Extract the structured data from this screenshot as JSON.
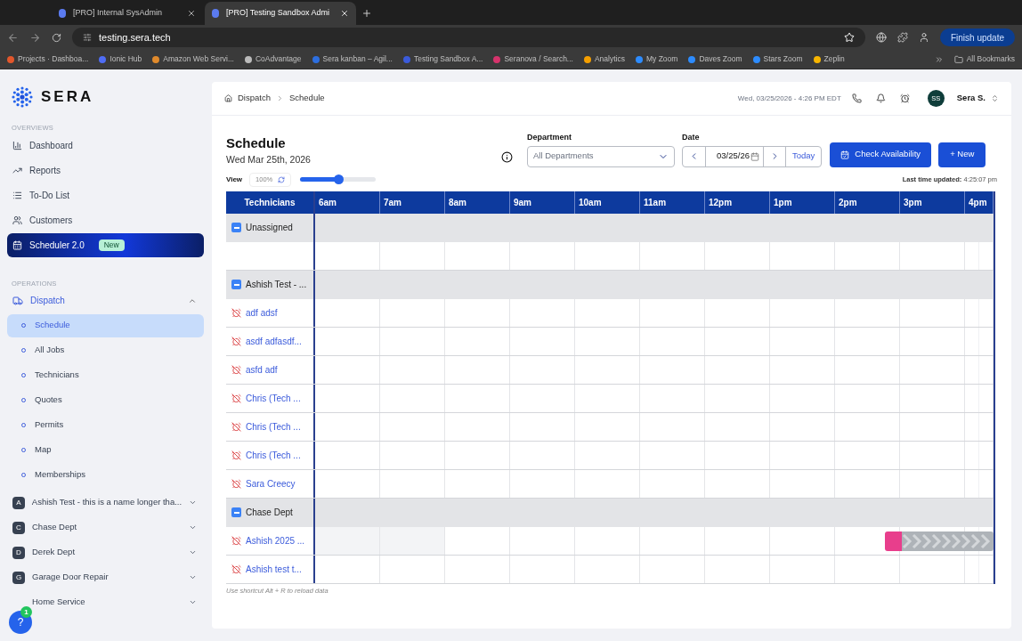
{
  "browser": {
    "tabs": [
      {
        "title": "[PRO] Internal SysAdmin",
        "selected": false
      },
      {
        "title": "[PRO] Testing Sandbox Admi",
        "selected": true
      }
    ],
    "address": "testing.sera.tech",
    "update_button": "Finish update",
    "bookmarks": [
      {
        "label": "Projects · Dashboa...",
        "color": "#e2572c"
      },
      {
        "label": "Ionic Hub",
        "color": "#4f6df5"
      },
      {
        "label": "Amazon Web Servi...",
        "color": "#e08a2c"
      },
      {
        "label": "CoAdvantage",
        "color": "#bbbbbb"
      },
      {
        "label": "Sera kanban – Agil...",
        "color": "#2d6fe0"
      },
      {
        "label": "Testing Sandbox A...",
        "color": "#3b5bdb"
      },
      {
        "label": "Seranova / Search...",
        "color": "#d6336c"
      },
      {
        "label": "Analytics",
        "color": "#f59f00"
      },
      {
        "label": "My Zoom",
        "color": "#2d8cff"
      },
      {
        "label": "Daves Zoom",
        "color": "#2d8cff"
      },
      {
        "label": "Stars Zoom",
        "color": "#2d8cff"
      },
      {
        "label": "Zeplin",
        "color": "#f7b500"
      }
    ],
    "all_bookmarks": "All Bookmarks"
  },
  "sidebar": {
    "logo": "SERA",
    "overviews_heading": "OVERVIEWS",
    "overviews": [
      {
        "label": "Dashboard"
      },
      {
        "label": "Reports"
      },
      {
        "label": "To-Do List"
      },
      {
        "label": "Customers"
      }
    ],
    "promo": {
      "label": "Scheduler 2.0",
      "badge": "New"
    },
    "operations_heading": "OPERATIONS",
    "dispatch": {
      "label": "Dispatch",
      "expanded": true,
      "children": [
        {
          "label": "Schedule",
          "selected": true
        },
        {
          "label": "All Jobs",
          "selected": false
        },
        {
          "label": "Technicians",
          "selected": false
        },
        {
          "label": "Quotes",
          "selected": false
        },
        {
          "label": "Permits",
          "selected": false
        },
        {
          "label": "Map",
          "selected": false
        },
        {
          "label": "Memberships",
          "selected": false
        }
      ]
    },
    "departments": [
      {
        "letter": "A",
        "label": "Ashish Test - this is a name longer tha..."
      },
      {
        "letter": "C",
        "label": "Chase Dept"
      },
      {
        "letter": "D",
        "label": "Derek Dept"
      },
      {
        "letter": "G",
        "label": "Garage Door Repair"
      },
      {
        "label": "Home Service"
      }
    ],
    "help": {
      "label": "?",
      "count": "1"
    }
  },
  "header": {
    "breadcrumbs": [
      "Dispatch",
      "Schedule"
    ],
    "datetime": "Wed, 03/25/2026 - 4:26 PM EDT",
    "initials": "SS",
    "user": "Sera S."
  },
  "schedule": {
    "title": "Schedule",
    "date": "Wed Mar 25th, 2026",
    "department_label": "Department",
    "department_placeholder": "All Departments",
    "date_label": "Date",
    "date_value": "03/25/26",
    "today": "Today",
    "check_availability": "Check Availability",
    "new": "+ New",
    "view_label": "View",
    "zoom": "100%",
    "zoom_slider": {
      "level": 0.5
    },
    "updated_label": "Last time updated:",
    "updated_value": "4:25:07 pm"
  },
  "grid": {
    "first_column": "Technicians",
    "hours": [
      "6am",
      "7am",
      "8am",
      "9am",
      "10am",
      "11am",
      "12pm",
      "1pm",
      "2pm",
      "3pm",
      "4pm"
    ],
    "rows": [
      {
        "kind": "group",
        "name": "Unassigned"
      },
      {
        "kind": "empty"
      },
      {
        "kind": "group",
        "name": "Ashish Test - ..."
      },
      {
        "kind": "tech",
        "name": "adf adsf"
      },
      {
        "kind": "tech",
        "name": "asdf adfasdf..."
      },
      {
        "kind": "tech",
        "name": "asfd adf"
      },
      {
        "kind": "tech",
        "name": "Chris (Tech ..."
      },
      {
        "kind": "tech",
        "name": "Chris (Tech ..."
      },
      {
        "kind": "tech",
        "name": "Chris (Tech ..."
      },
      {
        "kind": "tech",
        "name": "Sara Creecy"
      },
      {
        "kind": "group",
        "name": "Chase Dept"
      },
      {
        "kind": "tech",
        "name": "Ashish 2025 ...",
        "event": {
          "color": "#e83e8c"
        }
      },
      {
        "kind": "tech",
        "name": "Ashish test t..."
      }
    ],
    "hint": "Use shortcut Alt + R to reload data"
  }
}
